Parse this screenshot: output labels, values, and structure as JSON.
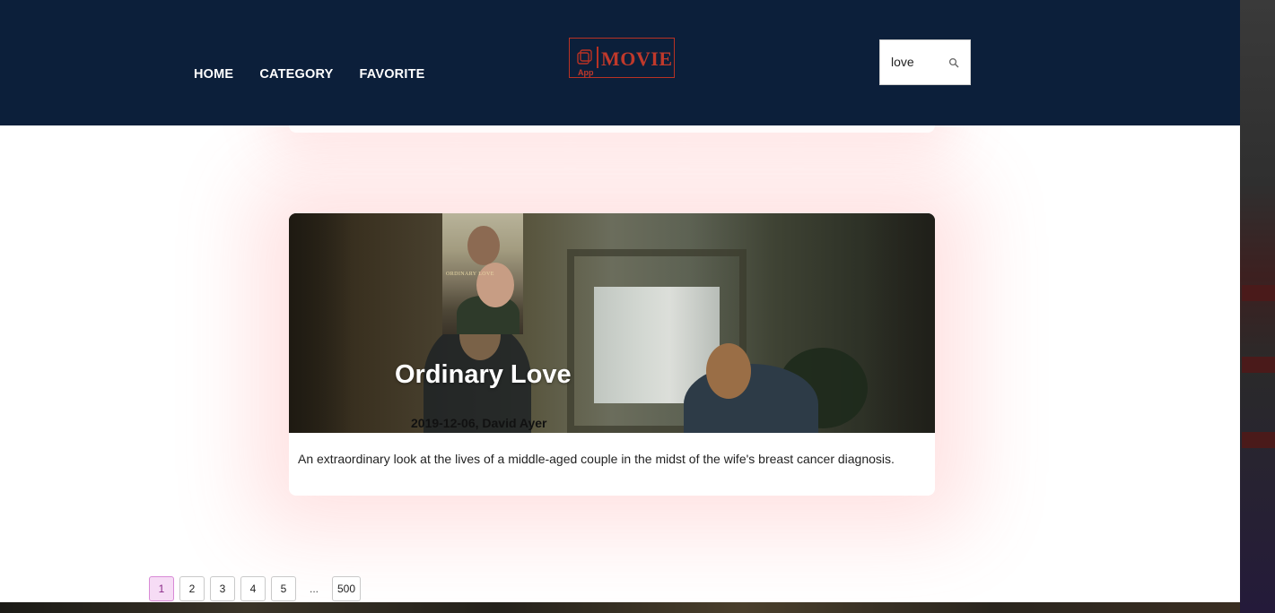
{
  "nav": {
    "home": "HOME",
    "category": "CATEGORY",
    "favorite": "FAVORITE"
  },
  "logo": {
    "main": "MOVIE",
    "sub": "App"
  },
  "search": {
    "value": "love"
  },
  "movie": {
    "title": "Ordinary Love",
    "meta": "2019-12-06, David Ayer",
    "overview": "An extraordinary look at the lives of a middle-aged couple in the midst of the wife's breast cancer diagnosis.",
    "poster_text": "ORDINARY LOVE"
  },
  "pagination": {
    "pages": [
      "1",
      "2",
      "3",
      "4",
      "5"
    ],
    "ellipsis": "...",
    "last": "500",
    "current": "1"
  }
}
